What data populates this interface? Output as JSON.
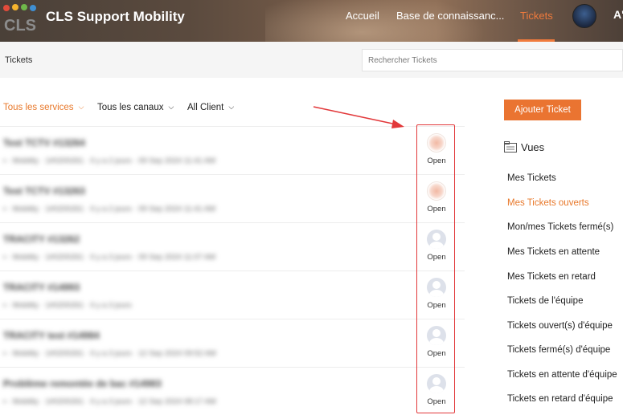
{
  "header": {
    "app_title": "CLS Support Mobility",
    "logo_text": "CLS",
    "nav": [
      "Accueil",
      "Base de connaissanc...",
      "Tickets"
    ],
    "nav_truncated_label": "A'",
    "accent_color": "#f07a3c"
  },
  "subheader": {
    "page_title": "Tickets",
    "search_placeholder": "Rechercher Tickets"
  },
  "filters": [
    {
      "label": "Tous les services",
      "active": true
    },
    {
      "label": "Tous les canaux",
      "active": false
    },
    {
      "label": "All Client",
      "active": false
    }
  ],
  "tickets": [
    {
      "title": "Test TCTV #13264",
      "meta": "▪ · Mobility · 1#0200261 · Il y a 2 jours · 09 Sep 2024 11:41 AM",
      "status": "Open",
      "avatar": "pink"
    },
    {
      "title": "Test TCTV #13263",
      "meta": "▪ · Mobility · 1#0200261 · Il y a 2 jours · 09 Sep 2024 11:41 AM",
      "status": "Open",
      "avatar": "pink"
    },
    {
      "title": "TRACITY #13262",
      "meta": "▪ · Mobility · 1#0200261 · Il y a 3 jours · 09 Sep 2024 11:07 AM",
      "status": "Open",
      "avatar": "grey"
    },
    {
      "title": "TRACITY #14993",
      "meta": "▪ · Mobility · 1#0200261 · Il y a 3 jours",
      "status": "Open",
      "avatar": "grey"
    },
    {
      "title": "TRACITY test #14984",
      "meta": "▪ · Mobility · 1#0200261 · Il y a 3 jours · 12 Sep 2024 09:52 AM",
      "status": "Open",
      "avatar": "grey"
    },
    {
      "title": "Problème remontée de bac #14983",
      "meta": "▪ · Mobility · 1#0200261 · Il y a 3 jours · 12 Sep 2024 08:17 AM",
      "status": "Open",
      "avatar": "grey"
    }
  ],
  "sidebar": {
    "add_ticket_label": "Ajouter Ticket",
    "views_title": "Vues",
    "views": [
      {
        "label": "Mes Tickets",
        "active": false
      },
      {
        "label": "Mes Tickets ouverts",
        "active": true
      },
      {
        "label": "Mon/mes Tickets fermé(s)",
        "active": false
      },
      {
        "label": "Mes Tickets en attente",
        "active": false
      },
      {
        "label": "Mes Tickets en retard",
        "active": false
      },
      {
        "label": "Tickets de l'équipe",
        "active": false
      },
      {
        "label": "Tickets ouvert(s) d'équipe",
        "active": false
      },
      {
        "label": "Tickets fermé(s) d'équipe",
        "active": false
      },
      {
        "label": "Tickets en attente d'équipe",
        "active": false
      },
      {
        "label": "Tickets en retard d'équipe",
        "active": false
      }
    ]
  },
  "annotation": {
    "color": "#e2383a"
  }
}
